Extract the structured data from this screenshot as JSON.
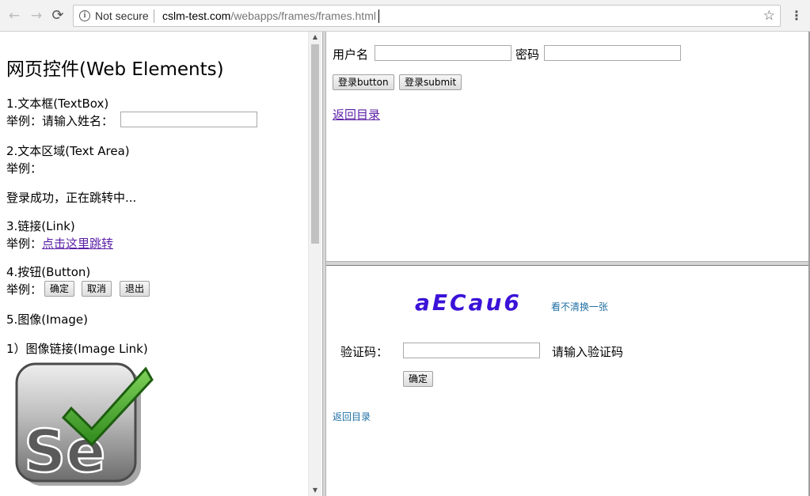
{
  "browser": {
    "security_label": "Not secure",
    "url_host": "cslm-test.com",
    "url_path": "/webapps/frames/frames.html",
    "back_glyph": "←",
    "forward_glyph": "→",
    "reload_glyph": "⟳",
    "info_glyph": "i",
    "star_glyph": "☆",
    "menu_glyph": "⋮"
  },
  "left_frame": {
    "title": "网页控件(Web Elements)",
    "textbox_section": "1.文本框(TextBox)",
    "textbox_example": "举例：请输入姓名：",
    "textbox_value": "",
    "textarea_section": "2.文本区域(Text Area)",
    "textarea_example": "举例：",
    "login_status": "登录成功，正在跳转中...",
    "link_section": "3.链接(Link)",
    "link_example": "举例：",
    "link_text": "点击这里跳转",
    "button_section": "4.按钮(Button)",
    "button_example": "举例：",
    "buttons": [
      "确定",
      "取消",
      "退出"
    ],
    "image_section": "5.图像(Image)",
    "image_link_section": "1）图像链接(Image Link)",
    "logo_text": "Se",
    "scroll_up": "▲",
    "scroll_down": "▼"
  },
  "top_right_frame": {
    "username_label": "用户名",
    "username_value": "",
    "password_label": "密码",
    "password_value": "",
    "login_button": "登录button",
    "submit_button": "登录submit",
    "back_link": "返回目录"
  },
  "bottom_right_frame": {
    "captcha_text": "aECau6",
    "refresh_link": "看不清换一张",
    "captcha_label": "验证码：",
    "captcha_value": "",
    "captcha_hint": "请输入验证码",
    "confirm_button": "确定",
    "back_link": "返回目录"
  },
  "colors": {
    "link_visited": "#5a1ea6",
    "captcha": "#3b12d8",
    "small_link": "#1f6fa3",
    "logo_check": "#4aa32b"
  }
}
